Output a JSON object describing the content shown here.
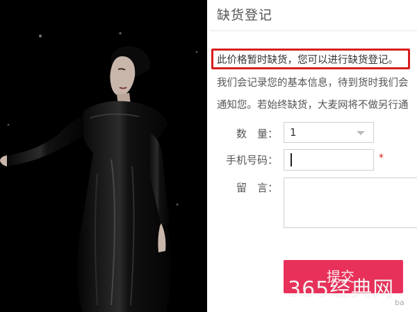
{
  "photo": {
    "alt": "woman in black dress",
    "background": "#000000"
  },
  "dialog": {
    "title": "缺货登记",
    "notice": "此价格暂时缺货，您可以进行缺货登记。",
    "info_line1": "我们会记录您的基本信息，待到货时我们会",
    "info_line2": "通知您。若始终缺货，大麦网将不做另行通",
    "accent_color": "#d61d1d"
  },
  "form": {
    "quantity_label": "数　量：",
    "quantity_value": "1",
    "phone_label": "手机号码：",
    "phone_value": "",
    "required_mark": "*",
    "message_label": "留　言：",
    "message_value": ""
  },
  "submit": {
    "label": "提交",
    "color": "#e8315a"
  },
  "watermark": {
    "text": "365经典网",
    "corner": "ba"
  }
}
